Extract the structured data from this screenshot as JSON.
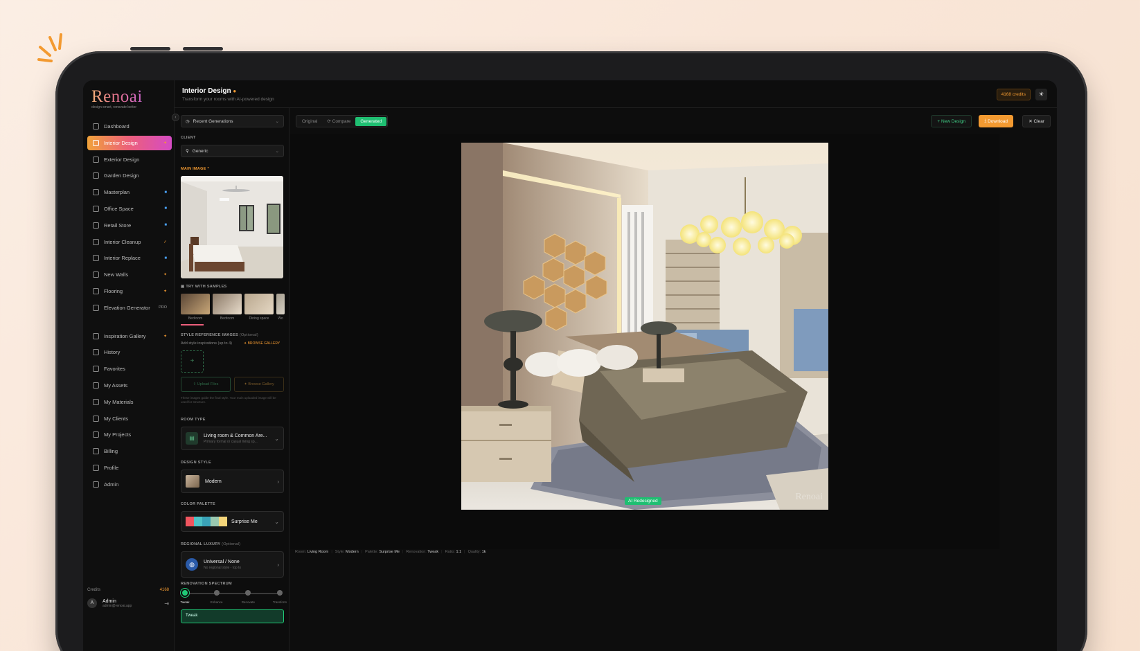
{
  "app": {
    "logo": "Renoai",
    "tagline": "design smart, renovate better"
  },
  "header": {
    "title": "Interior Design",
    "subtitle": "Transform your rooms with AI-powered design",
    "credits_pill": "4168 credits",
    "theme_icon": "sun-icon"
  },
  "sidebar": {
    "items": [
      {
        "label": "Dashboard",
        "icon": "home-icon",
        "badge": ""
      },
      {
        "label": "Interior Design",
        "icon": "sofa-icon",
        "badge": "✦",
        "active": true
      },
      {
        "label": "Exterior Design",
        "icon": "building-icon",
        "badge": ""
      },
      {
        "label": "Garden Design",
        "icon": "flower-icon",
        "badge": ""
      },
      {
        "label": "Masterplan",
        "icon": "map-icon",
        "badge": "■"
      },
      {
        "label": "Office Space",
        "icon": "office-icon",
        "badge": "■"
      },
      {
        "label": "Retail Store",
        "icon": "store-icon",
        "badge": "■"
      },
      {
        "label": "Interior Cleanup",
        "icon": "trash-icon",
        "badge": "✓"
      },
      {
        "label": "Interior Replace",
        "icon": "swap-icon",
        "badge": "■"
      },
      {
        "label": "New Walls",
        "icon": "wall-icon",
        "badge": "✦"
      },
      {
        "label": "Flooring",
        "icon": "floor-icon",
        "badge": "✦"
      },
      {
        "label": "Elevation Generator",
        "icon": "elevation-icon",
        "badge": "PRO"
      }
    ],
    "items2": [
      {
        "label": "Inspiration Gallery",
        "icon": "gallery-icon",
        "badge": "✦"
      },
      {
        "label": "History",
        "icon": "clock-icon",
        "badge": ""
      },
      {
        "label": "Favorites",
        "icon": "heart-icon",
        "badge": ""
      },
      {
        "label": "My Assets",
        "icon": "folder-icon",
        "badge": ""
      },
      {
        "label": "My Materials",
        "icon": "box-icon",
        "badge": ""
      },
      {
        "label": "My Clients",
        "icon": "users-icon",
        "badge": ""
      },
      {
        "label": "My Projects",
        "icon": "project-icon",
        "badge": ""
      },
      {
        "label": "Billing",
        "icon": "card-icon",
        "badge": ""
      },
      {
        "label": "Profile",
        "icon": "user-icon",
        "badge": ""
      },
      {
        "label": "Admin",
        "icon": "gear-icon",
        "badge": ""
      }
    ],
    "credits_label": "Credits",
    "credits_value": "4168",
    "user": {
      "initial": "A",
      "name": "Admin",
      "email": "admin@renoai.app"
    }
  },
  "panel": {
    "recent": "Recent Generations",
    "client_label": "CLIENT",
    "client_value": "Generic",
    "main_image_label": "MAIN IMAGE *",
    "samples_label": "TRY WITH SAMPLES",
    "samples": [
      "Bedroom",
      "Bedroom",
      "Dining space",
      "Wo"
    ],
    "style_ref_label": "STYLE REFERENCE IMAGES",
    "style_ref_optional": "(Optional)",
    "style_ref_desc": "Add style inspirations (up to 4)",
    "browse_gallery_link": "BROWSE GALLERY",
    "upload_files": "Upload Files",
    "browse_gallery": "Browse Gallery",
    "hint": "These images guide the final style. Your main uploaded image will be used for structure.",
    "room_type_label": "ROOM TYPE",
    "room_type_value": "Living room & Common Are...",
    "room_type_sub": "Primary formal or casual living sp...",
    "design_style_label": "DESIGN STYLE",
    "design_style_value": "Modern",
    "color_palette_label": "COLOR PALETTE",
    "color_palette_value": "Surprise Me",
    "palette_colors": [
      "#f0555f",
      "#4fc3c7",
      "#3aa3b8",
      "#9ac9b0",
      "#f4d57a"
    ],
    "regional_label": "REGIONAL LUXURY",
    "regional_optional": "(Optional)",
    "regional_value": "Universal / None",
    "regional_sub": "No regional style - top to",
    "spectrum_label": "RENOVATION SPECTRUM",
    "spectrum_stops": [
      "Tweak",
      "Enhance",
      "Renovate",
      "Transform"
    ],
    "spectrum_selected": "Tweak"
  },
  "viewer": {
    "tabs": [
      "Original",
      "Compare",
      "Generated"
    ],
    "active_tab": "Generated",
    "new_design": "New Design",
    "download": "Download",
    "clear": "Clear",
    "ai_badge": "AI Redesigned",
    "watermark": "Renoai",
    "meta": [
      {
        "k": "Room:",
        "v": "Living Room"
      },
      {
        "k": "Style:",
        "v": "Modern"
      },
      {
        "k": "Palette:",
        "v": "Surprise Me"
      },
      {
        "k": "Renovation:",
        "v": "Tweak"
      },
      {
        "k": "Ratio:",
        "v": "1:1"
      },
      {
        "k": "Quality:",
        "v": "1k"
      }
    ]
  },
  "colors": {
    "accent_green": "#1fbf72",
    "accent_orange": "#f39a31",
    "active_gradient": [
      "#f0a23a",
      "#ec5f7c",
      "#d54bc4"
    ]
  }
}
